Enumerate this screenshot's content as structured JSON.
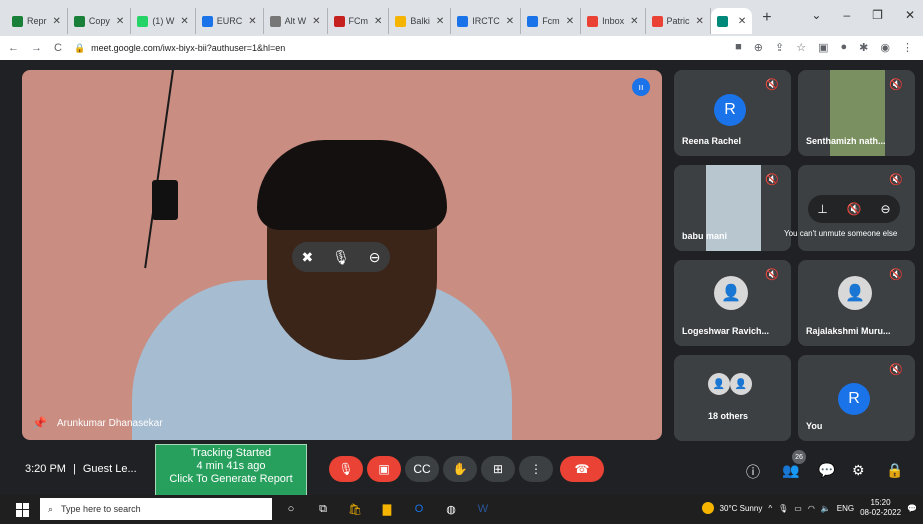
{
  "browser": {
    "tabs": [
      {
        "label": "Repr",
        "color": "#188038"
      },
      {
        "label": "Copy",
        "color": "#188038"
      },
      {
        "label": "(1) W",
        "color": "#25d366"
      },
      {
        "label": "EURC",
        "color": "#1a73e8"
      },
      {
        "label": "Alt W",
        "color": "#777777"
      },
      {
        "label": "FCm",
        "color": "#c5221f"
      },
      {
        "label": "Balki",
        "color": "#f4b400"
      },
      {
        "label": "IRCTC",
        "color": "#1a73e8"
      },
      {
        "label": "Fcm",
        "color": "#1a73e8"
      },
      {
        "label": "Inbox",
        "color": "#ea4335"
      },
      {
        "label": "Patric",
        "color": "#ea4335"
      },
      {
        "label": "",
        "color": "#00897b"
      }
    ],
    "url": "meet.google.com/iwx-biyx-bii?authuser=1&hl=en"
  },
  "main_tile": {
    "name": "Arunkumar Dhanasekar"
  },
  "tiles": [
    {
      "name": "Reena Rachel",
      "avatar": "R"
    },
    {
      "name": "Senthamizh nath..."
    },
    {
      "name": "babu mani"
    },
    {
      "name": "",
      "tooltip": "You can't unmute someone else"
    },
    {
      "name": "Logeshwar Ravich..."
    },
    {
      "name": "Rajalakshmi Muru..."
    },
    {
      "name": "18 others"
    },
    {
      "name": "You",
      "avatar": "R"
    }
  ],
  "bottom": {
    "time": "3:20 PM",
    "meeting": "Guest Le...",
    "tracking": [
      "Tracking Started",
      "4 min 41s ago",
      "Click To Generate Report"
    ],
    "participant_count": "26"
  },
  "taskbar": {
    "search_placeholder": "Type here to search",
    "weather": "30°C  Sunny",
    "lang": "ENG",
    "time": "15:20",
    "date": "08-02-2022"
  }
}
